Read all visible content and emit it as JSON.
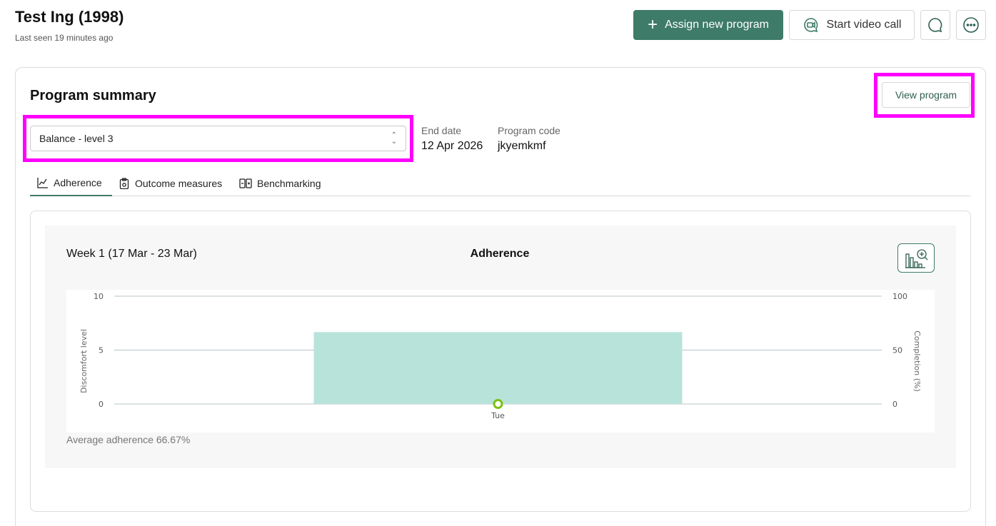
{
  "header": {
    "title": "Test Ing (1998)",
    "subtitle": "Last seen 19 minutes ago",
    "assign_label": "Assign new program",
    "video_label": "Start video call",
    "chat_icon": "chat-bubble-icon",
    "more_icon": "more-dots-icon"
  },
  "summary": {
    "title": "Program summary",
    "view_program_label": "View program",
    "selected_program": "Balance - level 3",
    "end_date_label": "End date",
    "end_date_value": "12 Apr 2026",
    "program_code_label": "Program code",
    "program_code_value": "jkyemkmf"
  },
  "tabs": [
    {
      "label": "Adherence",
      "icon": "line-chart-icon",
      "active": true
    },
    {
      "label": "Outcome measures",
      "icon": "clipboard-icon",
      "active": false
    },
    {
      "label": "Benchmarking",
      "icon": "compare-icon",
      "active": false
    }
  ],
  "adherence": {
    "week_label": "Week 1 (17 Mar - 23 Mar)",
    "title": "Adherence",
    "average_text": "Average adherence 66.67%"
  },
  "colors": {
    "primary": "#3e7b68",
    "bar": "#b8e3da",
    "marker": "#7cc114",
    "highlight": "#ff00ff"
  },
  "chart_data": {
    "type": "bar",
    "categories": [
      "Tue"
    ],
    "series": [
      {
        "name": "",
        "axis": "right",
        "type": "bar",
        "values": [
          66.67
        ]
      },
      {
        "name": "",
        "axis": "left",
        "type": "scatter",
        "values": [
          0
        ]
      }
    ],
    "ylabel": "Discomfort level",
    "ylim": [
      0,
      10
    ],
    "yticks": [
      "0",
      "5",
      "10"
    ],
    "y2label": "Completion (%)",
    "y2lim": [
      0,
      100
    ],
    "y2ticks": [
      "0",
      "50",
      "100"
    ],
    "grid": true
  }
}
